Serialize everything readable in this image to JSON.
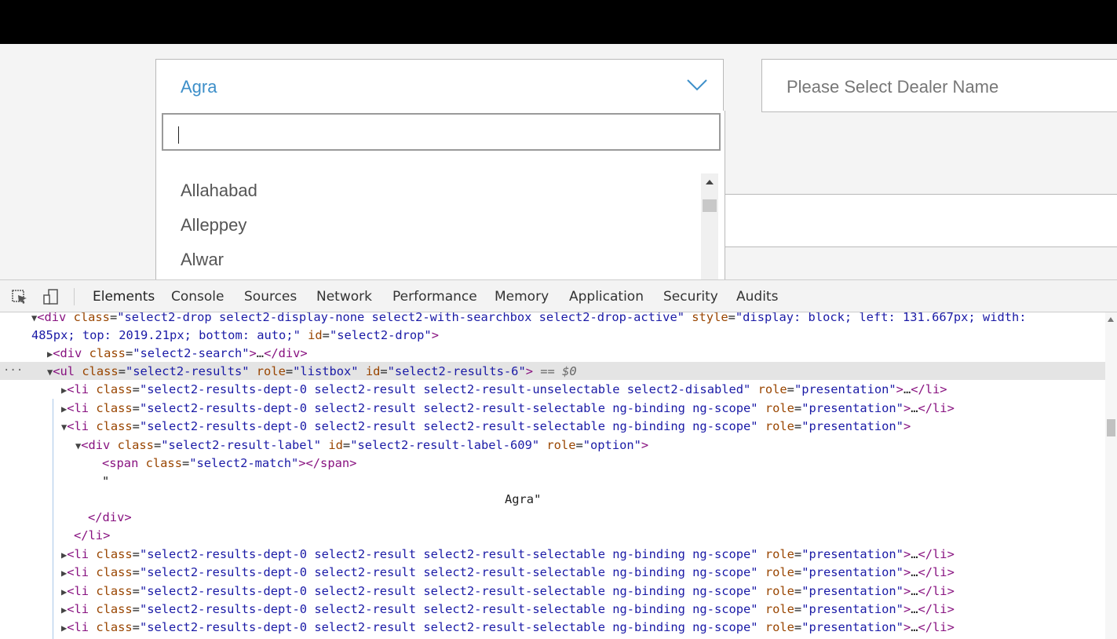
{
  "page": {
    "city_select": {
      "value": "Agra"
    },
    "dealer_select": {
      "placeholder": "Please Select Dealer Name"
    },
    "search": {
      "value": ""
    },
    "results": [
      "Allahabad",
      "Alleppey",
      "Alwar"
    ]
  },
  "devtools": {
    "tabs": [
      "Elements",
      "Console",
      "Sources",
      "Network",
      "Performance",
      "Memory",
      "Application",
      "Security",
      "Audits"
    ],
    "active_tab": "Elements",
    "selected_suffix": "== $0",
    "lines": {
      "l0a": "div",
      "l0b_attr": "class",
      "l0b_val": "\"select2-drop select2-display-none select2-with-searchbox select2-drop-active\"",
      "l0c_attr": "style",
      "l0c_val": "\"display: block; left: 131.667px; width:",
      "l1_val": "485px; top: 2019.21px; bottom: auto;\"",
      "l1_attr": "id",
      "l1_idval": "\"select2-drop\"",
      "l2_tag": "div",
      "l2_attr": "class",
      "l2_val": "\"select2-search\"",
      "l3_tag": "ul",
      "l3_cls": "\"select2-results\"",
      "l3_role": "\"listbox\"",
      "l3_id": "\"select2-results-6\"",
      "li_unselectable": "\"select2-results-dept-0 select2-result select2-result-unselectable select2-disabled\"",
      "li_selectable": "\"select2-results-dept-0 select2-result select2-result-selectable ng-binding ng-scope\"",
      "role_presentation": "\"presentation\"",
      "div_label_cls": "\"select2-result-label\"",
      "div_label_id": "\"select2-result-label-609\"",
      "div_label_role": "\"option\"",
      "span_cls": "\"select2-match\"",
      "text_quote": "\"",
      "text_agra": "Agra\""
    }
  }
}
